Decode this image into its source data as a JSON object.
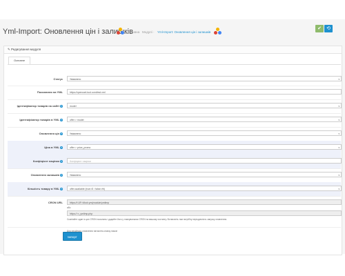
{
  "header": {
    "title": "Yml-Import: Оновлення цін і залишків",
    "breadcrumbs": [
      "Головна",
      "Модулі",
      "Yml-Import: Оновлення цін і залишків"
    ],
    "breadcrumb_sep": "›",
    "save_icon": "✔",
    "cancel_icon": "⟲"
  },
  "tooltip": "opencart-tool",
  "panel": {
    "title": "Редагування модуля",
    "tab": "Основне"
  },
  "form": {
    "status": {
      "label": "Статус",
      "value": "Увімкнено"
    },
    "yml_url": {
      "label": "Посилання на YML",
      "value": "https://opencart-tool.com/test.xml"
    },
    "site_id": {
      "label": "Ідентифікатор товарів на сайті",
      "value": "model"
    },
    "yml_id": {
      "label": "Ідентифікатор товарів в YML",
      "value": "offer > model"
    },
    "price_update": {
      "label": "Оновлення цін",
      "value": "Увімкнено"
    },
    "price_yml": {
      "label": "Ціна в YML",
      "value": "offer > price_promo"
    },
    "ratio": {
      "label": "Коефіцієнт націнки",
      "placeholder": "Коефіцієнт націнки"
    },
    "stock_update": {
      "label": "Оновлення залишків",
      "value": "Увімкнено"
    },
    "qty_yml": {
      "label": "Кількість товару в YML",
      "value": "offer.available (true=Є / false=Ні)"
    },
    "cron": {
      "label": "CRON URL",
      "url1": "https://t                         &F=Mod=ym(module/ymlimp",
      "or": "або",
      "url2": "https://                        n_ymlimp.php",
      "note": "Скопіюйте один із цих CRON посилань і додайте його у планувальник CRON на вашому хостингу. Встановіть там потрібну періодичність запуску оновлення."
    },
    "manual_note": "Для негайного оновлення натисніть кнопку нижче",
    "import_button": "Імпорт"
  }
}
